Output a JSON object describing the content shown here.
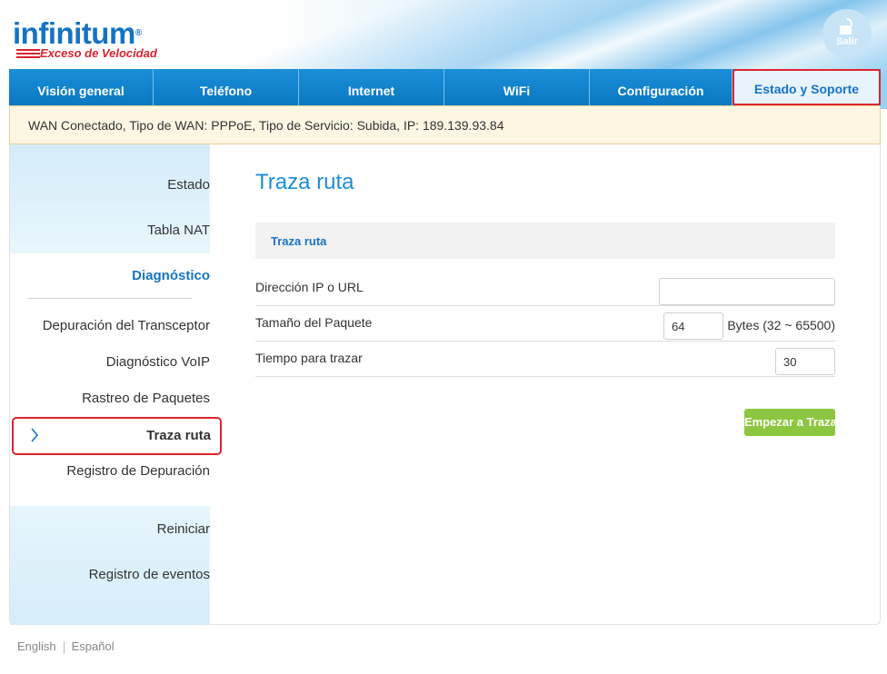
{
  "brand": {
    "name": "infinitum",
    "reg": "®",
    "tagline": "Exceso de Velocidad",
    "logout_label": "Salir"
  },
  "nav": {
    "tabs": [
      {
        "label": "Visión general"
      },
      {
        "label": "Teléfono"
      },
      {
        "label": "Internet"
      },
      {
        "label": "WiFi"
      },
      {
        "label": "Configuración"
      },
      {
        "label": "Estado y Soporte",
        "active": true
      }
    ]
  },
  "status_bar": {
    "text": "WAN Conectado, Tipo de WAN: PPPoE, Tipo de Servicio: Subida, IP: 189.139.93.84"
  },
  "sidebar": {
    "items": [
      {
        "label": "Estado"
      },
      {
        "label": "Tabla NAT"
      },
      {
        "label": "Diagnóstico"
      },
      {
        "label": "Depuración del Transceptor"
      },
      {
        "label": "Diagnóstico VoIP"
      },
      {
        "label": "Rastreo de Paquetes"
      },
      {
        "label": "Traza ruta",
        "active": true
      },
      {
        "label": "Registro de Depuración"
      },
      {
        "label": "Reiniciar"
      },
      {
        "label": "Registro de eventos"
      }
    ]
  },
  "main": {
    "title": "Traza ruta",
    "section_title": "Traza ruta",
    "fields": {
      "ip": {
        "label": "Dirección IP o URL",
        "value": ""
      },
      "packet_size": {
        "label": "Tamaño del Paquete",
        "value": "64",
        "unit": "Bytes (32 ~ 65500)"
      },
      "trace_time": {
        "label": "Tiempo para trazar",
        "value": "30"
      }
    },
    "start_button": "Empezar a Traza"
  },
  "footer": {
    "lang_en": "English",
    "lang_es": "Español"
  },
  "colors": {
    "accent": "#1a8fd8",
    "nav_bg": "#0d7fc9",
    "highlight": "#e0232e",
    "button": "#8cc63f",
    "status_bg": "#fdf6e3"
  }
}
